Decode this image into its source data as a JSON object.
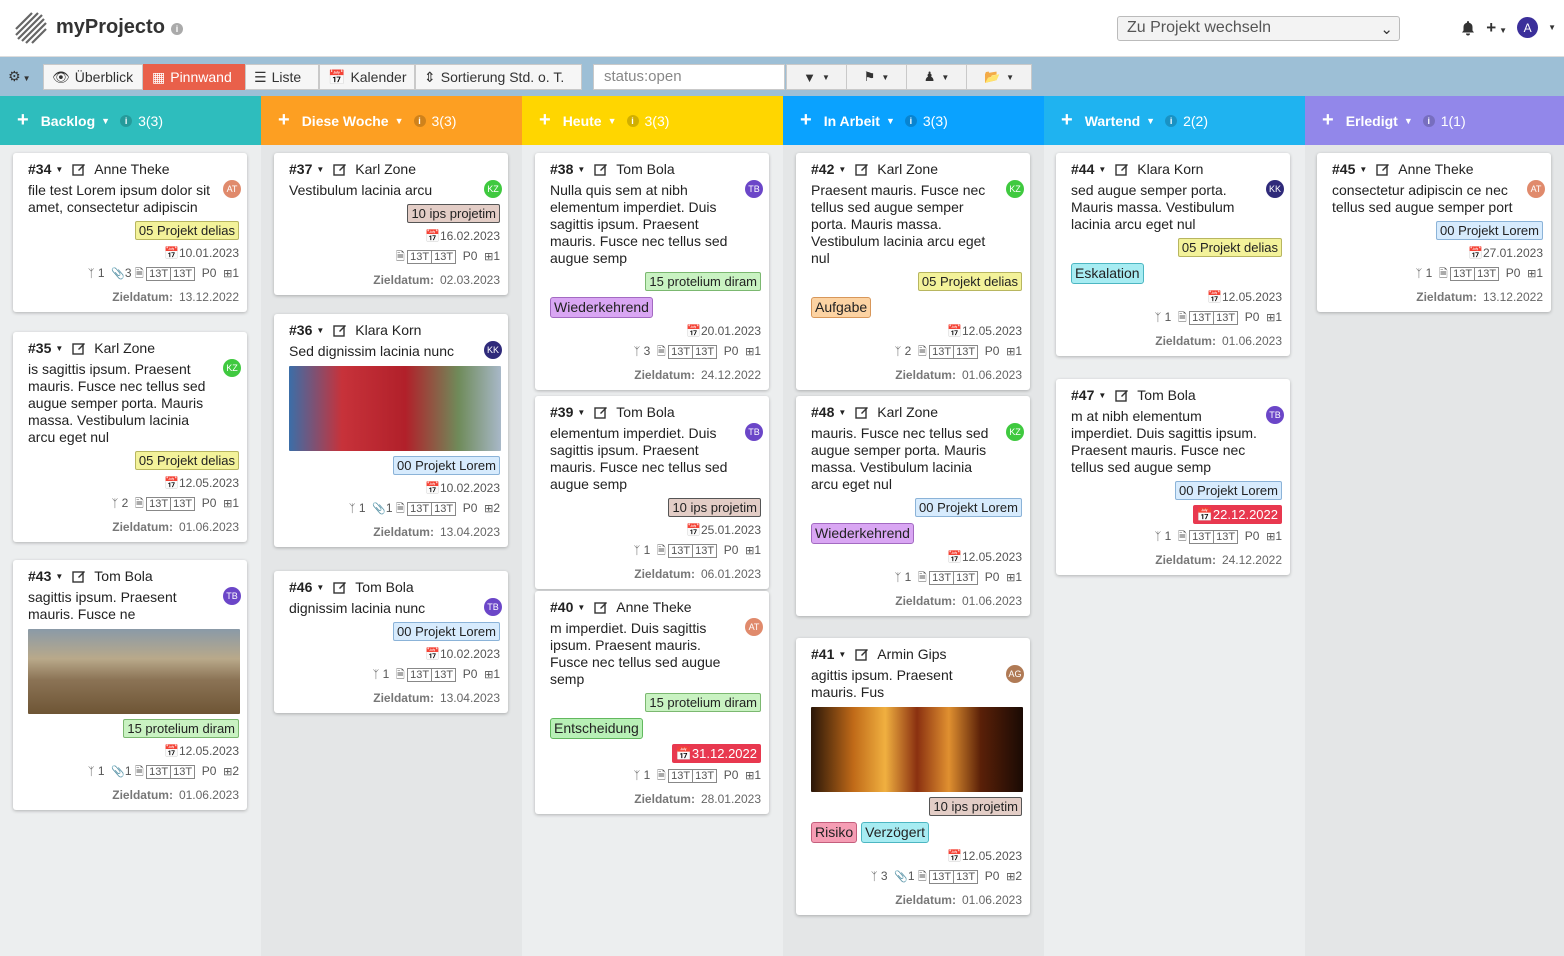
{
  "app": {
    "title": "myProjecto",
    "project_select": "Zu Projekt wechseln",
    "user_initial": "A"
  },
  "toolbar": {
    "buttons": [
      "Überblick",
      "Pinnwand",
      "Liste",
      "Kalender",
      "Sortierung Std. o. T."
    ],
    "search_value": "status:open"
  },
  "labels": {
    "ziel": "Zieldatum:",
    "wh": "13T",
    "prio": "P0"
  },
  "columns": [
    {
      "name": "Backlog",
      "count": "3(3)",
      "color": "#2ebdbd"
    },
    {
      "name": "Diese Woche",
      "count": "3(3)",
      "color": "#fd9f22"
    },
    {
      "name": "Heute",
      "count": "3(3)",
      "color": "#ffd600"
    },
    {
      "name": "In Arbeit",
      "count": "3(3)",
      "color": "#0aa2ff"
    },
    {
      "name": "Wartend",
      "count": "2(2)",
      "color": "#1fb3f0"
    },
    {
      "name": "Erledigt",
      "count": "1(1)",
      "color": "#9287ea"
    }
  ],
  "cards": [
    {
      "id": "#34",
      "user": "Anne Theke",
      "initials": "AT",
      "text": "file test Lorem ipsum dolor sit amet, consectetur adipiscin",
      "label": "05 Projekt delias",
      "date": "10.01.2023",
      "c1": "1",
      "c2": "3",
      "ziel": "13.12.2022",
      "n": "1"
    },
    {
      "id": "#35",
      "user": "Karl Zone",
      "initials": "KZ",
      "text": "is sagittis ipsum. Praesent mauris. Fusce nec tellus sed augue semper porta. Mauris massa. Vestibulum lacinia arcu eget nul",
      "label": "05 Projekt delias",
      "date": "12.05.2023",
      "c1": "2",
      "ziel": "01.06.2023",
      "n": "1"
    },
    {
      "id": "#43",
      "user": "Tom Bola",
      "initials": "TB",
      "text": "sagittis ipsum. Praesent mauris. Fusce ne",
      "label": "15 protelium diram",
      "date": "12.05.2023",
      "c1": "1",
      "c2": "1",
      "ziel": "01.06.2023",
      "n": "2"
    },
    {
      "id": "#37",
      "user": "Karl Zone",
      "initials": "KZ",
      "text": "Vestibulum lacinia arcu",
      "label": "10 ips projetim",
      "date": "16.02.2023",
      "ziel": "02.03.2023",
      "n": "1"
    },
    {
      "id": "#36",
      "user": "Klara Korn",
      "initials": "KK",
      "text": "Sed dignissim lacinia nunc",
      "label": "00 Projekt Lorem",
      "date": "10.02.2023",
      "c1": "1",
      "c2": "1",
      "ziel": "13.04.2023",
      "n": "2"
    },
    {
      "id": "#46",
      "user": "Tom Bola",
      "initials": "TB",
      "text": "dignissim lacinia nunc",
      "label": "00 Projekt Lorem",
      "date": "10.02.2023",
      "c1": "1",
      "ziel": "13.04.2023",
      "n": "1"
    },
    {
      "id": "#38",
      "user": "Tom Bola",
      "initials": "TB",
      "text": "Nulla quis sem at nibh elementum imperdiet. Duis sagittis ipsum. Praesent mauris. Fusce nec tellus sed augue semp",
      "label": "15 protelium diram",
      "tag": "Wiederkehrend",
      "date": "20.01.2023",
      "c1": "3",
      "ziel": "24.12.2022",
      "n": "1"
    },
    {
      "id": "#39",
      "user": "Tom Bola",
      "initials": "TB",
      "text": "elementum imperdiet. Duis sagittis ipsum. Praesent mauris. Fusce nec tellus sed augue semp",
      "label": "10 ips projetim",
      "date": "25.01.2023",
      "c1": "1",
      "ziel": "06.01.2023",
      "n": "1"
    },
    {
      "id": "#40",
      "user": "Anne Theke",
      "initials": "AT",
      "text": "m imperdiet. Duis sagittis ipsum. Praesent mauris. Fusce nec tellus sed augue semp",
      "label": "15 protelium diram",
      "tag": "Entscheidung",
      "date": "31.12.2022",
      "c1": "1",
      "ziel": "28.01.2023",
      "n": "1"
    },
    {
      "id": "#42",
      "user": "Karl Zone",
      "initials": "KZ",
      "text": "Praesent mauris. Fusce nec tellus sed augue semper porta. Mauris massa. Vestibulum lacinia arcu eget nul",
      "label": "05 Projekt delias",
      "tag": "Aufgabe",
      "date": "12.05.2023",
      "c1": "2",
      "ziel": "01.06.2023",
      "n": "1"
    },
    {
      "id": "#48",
      "user": "Karl Zone",
      "initials": "KZ",
      "text": "mauris. Fusce nec tellus sed augue semper porta. Mauris massa. Vestibulum lacinia arcu eget nul",
      "label": "00 Projekt Lorem",
      "tag": "Wiederkehrend",
      "date": "12.05.2023",
      "c1": "1",
      "ziel": "01.06.2023",
      "n": "1"
    },
    {
      "id": "#41",
      "user": "Armin Gips",
      "initials": "AG",
      "text": "agittis ipsum. Praesent mauris. Fus",
      "label": "10 ips projetim",
      "tag": "Risiko",
      "tag2": "Verzögert",
      "date": "12.05.2023",
      "c1": "3",
      "c2": "1",
      "ziel": "01.06.2023",
      "n": "2"
    },
    {
      "id": "#44",
      "user": "Klara Korn",
      "initials": "KK",
      "text": "sed augue semper porta. Mauris massa. Vestibulum lacinia arcu eget nul",
      "label": "05 Projekt delias",
      "tag": "Eskalation",
      "date": "12.05.2023",
      "c1": "1",
      "ziel": "01.06.2023",
      "n": "1"
    },
    {
      "id": "#47",
      "user": "Tom Bola",
      "initials": "TB",
      "text": "m at nibh elementum imperdiet. Duis sagittis ipsum. Praesent mauris. Fusce nec tellus sed augue semp",
      "label": "00 Projekt Lorem",
      "date": "22.12.2022",
      "c1": "1",
      "ziel": "24.12.2022",
      "n": "1"
    },
    {
      "id": "#45",
      "user": "Anne Theke",
      "initials": "AT",
      "text": "consectetur adipiscin ce nec tellus sed augue semper port",
      "label": "00 Projekt Lorem",
      "date": "27.01.2023",
      "c1": "1",
      "ziel": "13.12.2022",
      "n": "1"
    }
  ],
  "colors": {
    "avatar_AT": "#e08a6c",
    "avatar_KZ": "#3fc93f",
    "avatar_KK": "#2f2a7a",
    "avatar_TB": "#6b46c8",
    "avatar_AG": "#b07a55",
    "overdue": "#e8384f"
  }
}
